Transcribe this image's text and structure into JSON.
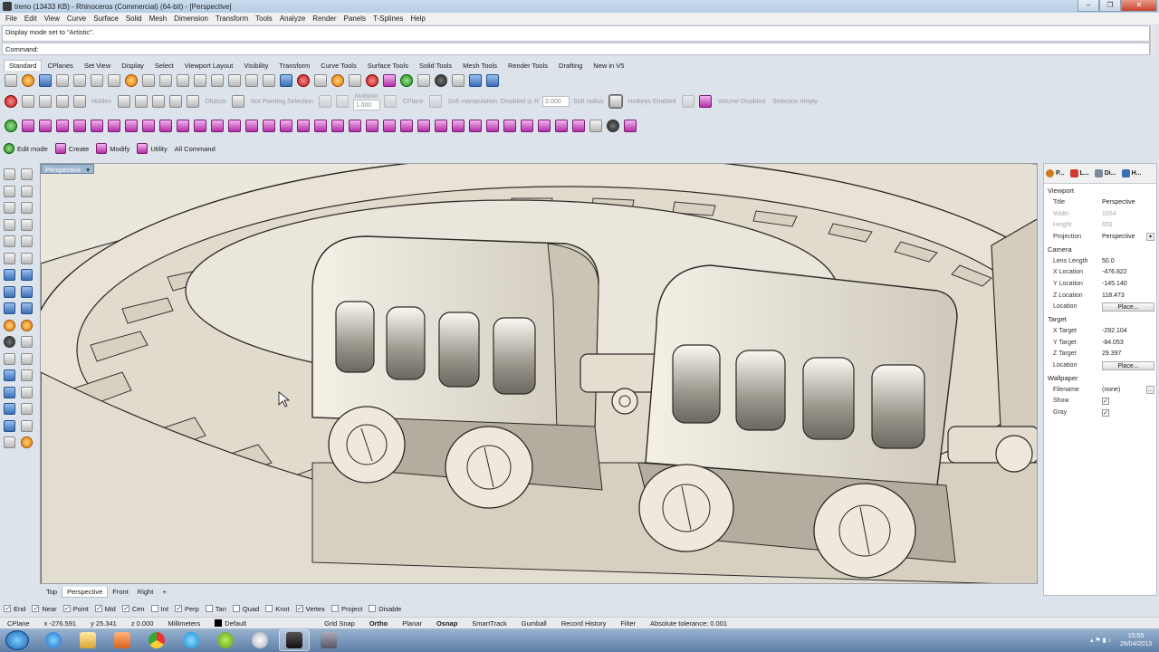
{
  "window": {
    "title": "treno (13433 KB) - Rhinoceros (Commercial) (64-bit) - [Perspective]"
  },
  "menu": [
    "File",
    "Edit",
    "View",
    "Curve",
    "Surface",
    "Solid",
    "Mesh",
    "Dimension",
    "Transform",
    "Tools",
    "Analyze",
    "Render",
    "Panels",
    "T-Splines",
    "Help"
  ],
  "command": {
    "history": "Display mode set to \"Artistic\".",
    "prompt": "Command:"
  },
  "toolbar_tabs": [
    "Standard",
    "CPlanes",
    "Set View",
    "Display",
    "Select",
    "Viewport Layout",
    "Visibility",
    "Transform",
    "Curve Tools",
    "Surface Tools",
    "Solid Tools",
    "Mesh Tools",
    "Render Tools",
    "Drafting",
    "New in V5"
  ],
  "tsplines_bar": {
    "hidden": "Hidden",
    "objects": "Objects",
    "not_painting": "Not Painting Selection",
    "multiplier_label": "Multiplier",
    "multiplier_value": "1.000",
    "cplane": "CPlane",
    "soft_manip": "Soft manipulation: Disabled",
    "radius_value": "2.000",
    "soft_radius": "Soft radius",
    "hotkeys": "Hotkeys",
    "enabled": "Enabled",
    "volume": "Volume Disabled",
    "selection": "Selection empty"
  },
  "mode_bar": [
    "Edit mode",
    "Create",
    "Modify",
    "Utility",
    "All Command"
  ],
  "viewport": {
    "label": "Perspective"
  },
  "viewport_tabs": [
    "Top",
    "Perspective",
    "Front",
    "Right"
  ],
  "panel": {
    "tabs": [
      "P...",
      "L...",
      "Di...",
      "H..."
    ],
    "viewport_section": "Viewport",
    "viewport_rows": [
      {
        "key": "Title",
        "value": "Perspective"
      },
      {
        "key": "Width",
        "value": "1654"
      },
      {
        "key": "Height",
        "value": "659"
      },
      {
        "key": "Projection",
        "value": "Perspective"
      }
    ],
    "camera_section": "Camera",
    "camera_rows": [
      {
        "key": "Lens Length",
        "value": "50.0"
      },
      {
        "key": "X Location",
        "value": "-476.822"
      },
      {
        "key": "Y Location",
        "value": "-145.140"
      },
      {
        "key": "Z Location",
        "value": "118.473"
      },
      {
        "key": "Location",
        "value": "Place..."
      }
    ],
    "target_section": "Target",
    "target_rows": [
      {
        "key": "X Target",
        "value": "-292.104"
      },
      {
        "key": "Y Target",
        "value": "-84.053"
      },
      {
        "key": "Z Target",
        "value": "29.397"
      },
      {
        "key": "Location",
        "value": "Place..."
      }
    ],
    "wallpaper_section": "Wallpaper",
    "wallpaper_rows": [
      {
        "key": "Filename",
        "value": "(none)"
      },
      {
        "key": "Show",
        "value": "✓"
      },
      {
        "key": "Gray",
        "value": "✓"
      }
    ]
  },
  "osnap": [
    "End",
    "Near",
    "Point",
    "Mid",
    "Cen",
    "Int",
    "Perp",
    "Tan",
    "Quad",
    "Knot",
    "Vertex",
    "Project",
    "Disable"
  ],
  "osnap_checked": [
    true,
    true,
    true,
    true,
    true,
    false,
    true,
    false,
    false,
    false,
    true,
    false,
    false
  ],
  "status": {
    "cplane": "CPlane",
    "x": "x -276.591",
    "y": "y 25.341",
    "z": "z 0.000",
    "units": "Millimeters",
    "layer": "Default",
    "grid_snap": "Grid Snap",
    "ortho": "Ortho",
    "planar": "Planar",
    "osnap": "Osnap",
    "smarttrack": "SmartTrack",
    "gumball": "Gumball",
    "record_history": "Record History",
    "filter": "Filter",
    "tolerance": "Absolute tolerance: 0.001"
  },
  "clock": {
    "time": "15:55",
    "date": "26/04/2013"
  }
}
